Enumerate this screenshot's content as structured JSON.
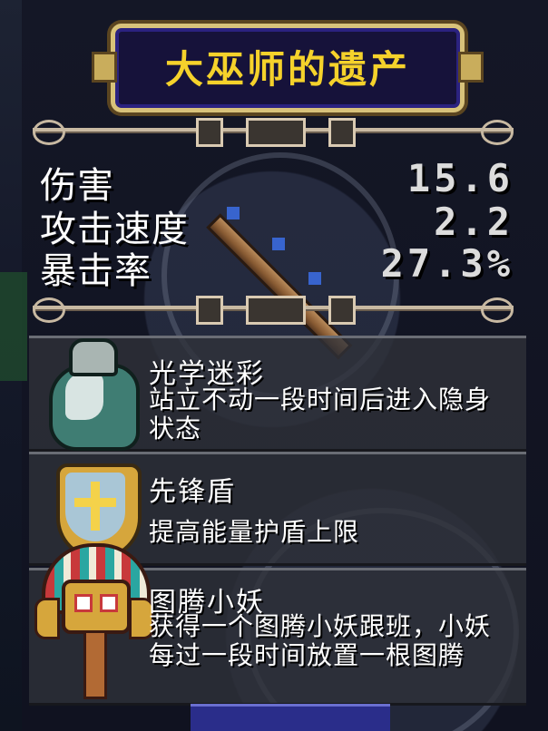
{
  "title": "大巫师的遗产",
  "stats": [
    {
      "label": "伤害",
      "value": "15.6"
    },
    {
      "label": "攻击速度",
      "value": "2.2"
    },
    {
      "label": "暴击率",
      "value": "27.3%"
    }
  ],
  "items": [
    {
      "icon": "cloak-icon",
      "name": "光学迷彩",
      "desc": "站立不动一段时间后进入隐身状态"
    },
    {
      "icon": "shield-icon",
      "name": "先锋盾",
      "desc": "提高能量护盾上限"
    },
    {
      "icon": "totem-icon",
      "name": "图腾小妖",
      "desc": "获得一个图腾小妖跟班，小妖每过一段时间放置一根图腾"
    }
  ],
  "colors": {
    "title_text": "#f5d22b",
    "title_plate": "#16123a",
    "frame_gold": "#d8c27a"
  }
}
